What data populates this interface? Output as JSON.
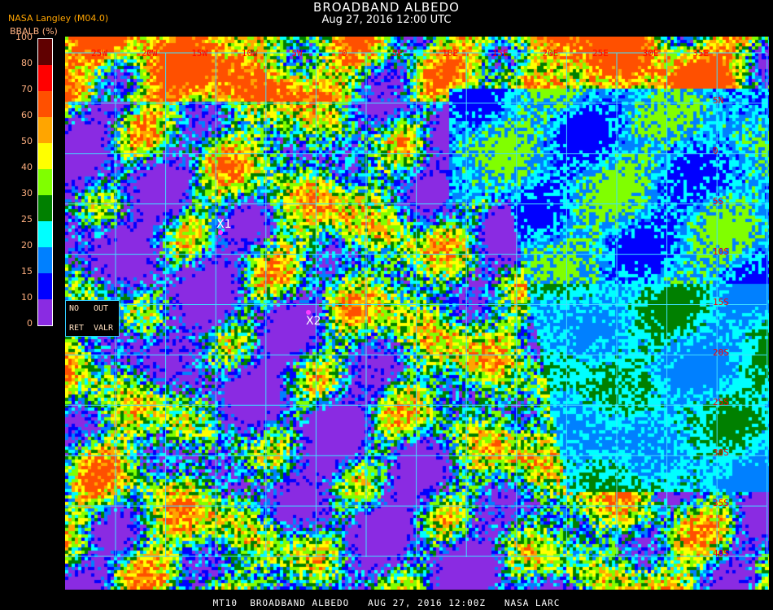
{
  "header": {
    "title": "BROADBAND ALBEDO",
    "datetime": "Aug 27, 2016 12:00 UTC"
  },
  "source": "NASA Langley (M04.0)",
  "legend": {
    "unit": "BBALB (%)",
    "ticks": [
      "0",
      "10",
      "15",
      "20",
      "25",
      "30",
      "40",
      "50",
      "60",
      "70",
      "80",
      "100"
    ],
    "colors": [
      "#8a2be2",
      "#0000ff",
      "#0080ff",
      "#00ffff",
      "#008000",
      "#80ff00",
      "#ffff00",
      "#ffa500",
      "#ff5000",
      "#ff0000",
      "#600000"
    ]
  },
  "map": {
    "lon_labels": [
      "25W",
      "20W",
      "15W",
      "10W",
      "5W",
      "0",
      "5E",
      "10E",
      "15E",
      "20E",
      "25E",
      "30E",
      "35E"
    ],
    "lat_labels": [
      "5N",
      "0",
      "5S",
      "10S",
      "15S",
      "20S",
      "25S",
      "30S",
      "35S",
      "40S"
    ],
    "grid_color": "#40e0ff",
    "label_color": "#ff0000",
    "markers": [
      {
        "label": "X1"
      },
      {
        "label": "X2"
      }
    ],
    "marker_color": "#ff3cff"
  },
  "nodata_box": {
    "no": "NO",
    "out": "OUT",
    "ret": "RET",
    "valr": "VALR"
  },
  "footer": "MT10  BROADBAND ALBEDO   AUG 27, 2016 12:00Z   NASA LARC"
}
